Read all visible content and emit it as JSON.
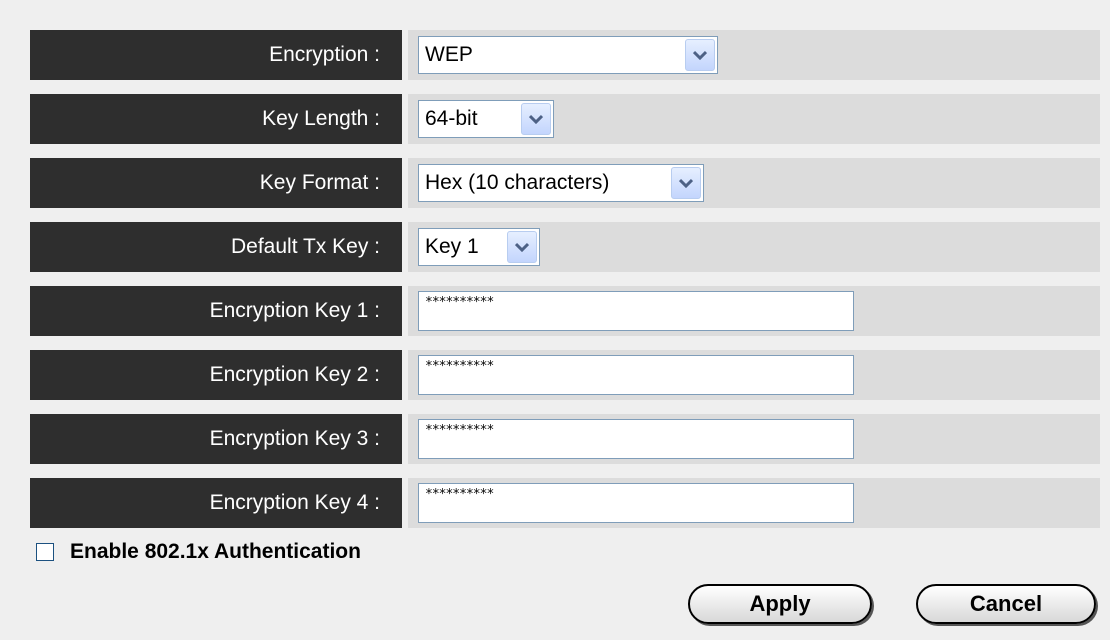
{
  "form": {
    "rows": [
      {
        "label": "Encryption :",
        "type": "select",
        "value": "WEP"
      },
      {
        "label": "Key Length :",
        "type": "select",
        "value": "64-bit"
      },
      {
        "label": "Key Format :",
        "type": "select",
        "value": "Hex (10 characters)"
      },
      {
        "label": "Default Tx Key :",
        "type": "select",
        "value": "Key 1"
      },
      {
        "label": "Encryption Key 1 :",
        "type": "text",
        "value": "**********"
      },
      {
        "label": "Encryption Key 2 :",
        "type": "text",
        "value": "**********"
      },
      {
        "label": "Encryption Key 3 :",
        "type": "text",
        "value": "**********"
      },
      {
        "label": "Encryption Key 4 :",
        "type": "text",
        "value": "**********"
      }
    ]
  },
  "auth": {
    "checkbox_label": "Enable 802.1x Authentication",
    "checked": false
  },
  "buttons": {
    "apply": "Apply",
    "cancel": "Cancel"
  },
  "colors": {
    "label_bg": "#2e2e2e",
    "cell_bg": "#dcdcdc",
    "page_bg": "#efefef"
  }
}
